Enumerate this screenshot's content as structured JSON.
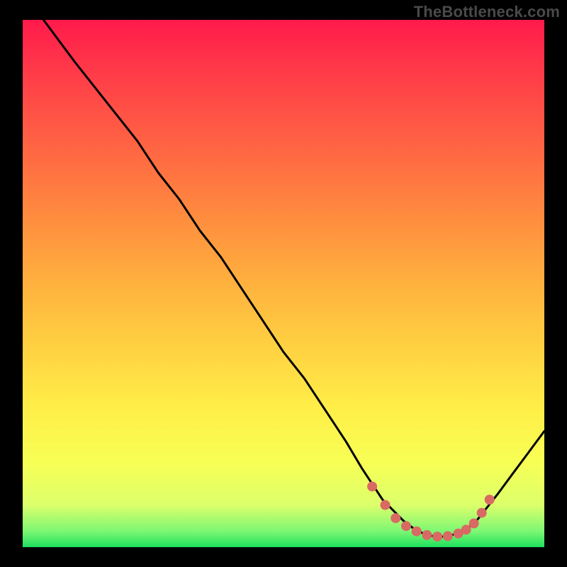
{
  "watermark": "TheBottleneck.com",
  "chart_data": {
    "type": "line",
    "title": "",
    "xlabel": "",
    "ylabel": "",
    "xlim": [
      0,
      100
    ],
    "ylim": [
      0,
      100
    ],
    "grid": false,
    "series": [
      {
        "name": "curve",
        "color": "#000000",
        "x": [
          4,
          7,
          10,
          14,
          18,
          22,
          26,
          30,
          34,
          38,
          42,
          46,
          50,
          54,
          58,
          62,
          65,
          67,
          69,
          71,
          73,
          75,
          77,
          79,
          81,
          83,
          85,
          87,
          89,
          91,
          94,
          97,
          100
        ],
        "y": [
          100,
          96,
          92,
          87,
          82,
          77,
          71,
          66,
          60,
          55,
          49,
          43,
          37,
          32,
          26,
          20,
          15,
          12,
          9,
          7,
          5,
          3.5,
          2.5,
          2,
          2,
          2.5,
          3.3,
          5,
          7.5,
          10,
          14,
          18,
          22
        ]
      },
      {
        "name": "optimal-dots",
        "color": "#d96a63",
        "marker": "circle",
        "marker_size": 7,
        "x": [
          67,
          69.5,
          71.5,
          73.5,
          75.5,
          77.5,
          79.5,
          81.5,
          83.5,
          85,
          86.5,
          88,
          89.5
        ],
        "y": [
          11.5,
          8,
          5.5,
          4,
          3,
          2.3,
          2,
          2.1,
          2.6,
          3.3,
          4.5,
          6.5,
          9
        ]
      }
    ],
    "legend": false
  },
  "colors": {
    "background_frame": "#000000",
    "gradient_top": "#ff1a4b",
    "gradient_bottom": "#1ee05e",
    "curve": "#000000",
    "dots": "#d96a63",
    "watermark": "#4a4a4a"
  }
}
